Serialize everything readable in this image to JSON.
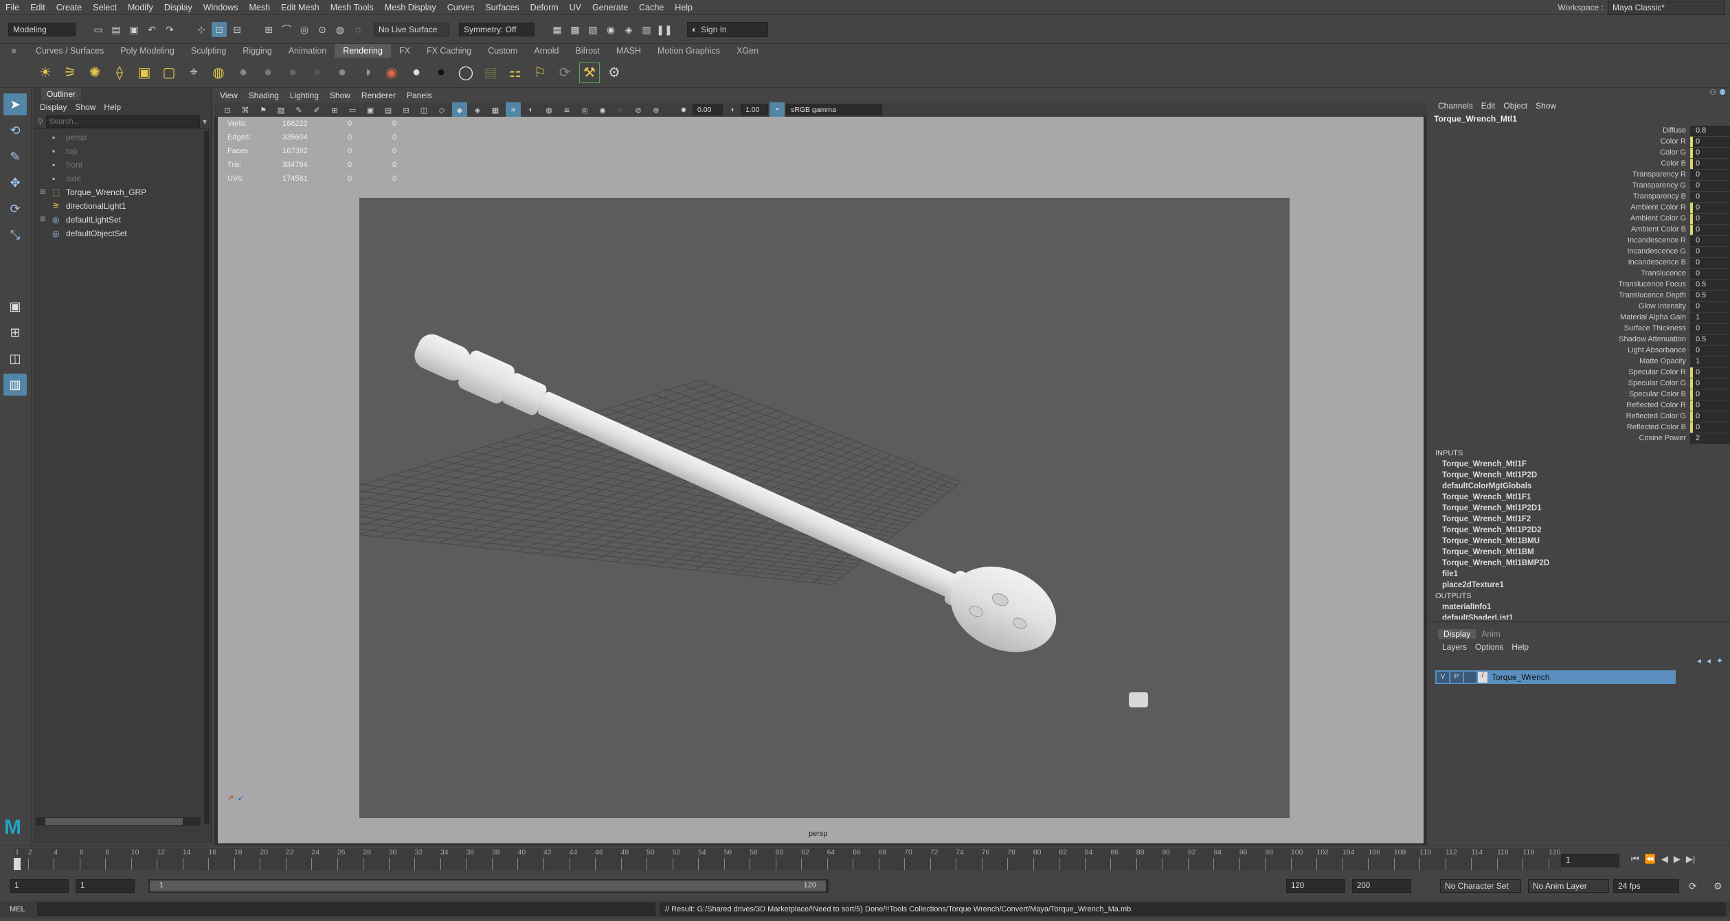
{
  "menubar": {
    "items": [
      "File",
      "Edit",
      "Create",
      "Select",
      "Modify",
      "Display",
      "Windows",
      "Mesh",
      "Edit Mesh",
      "Mesh Tools",
      "Mesh Display",
      "Curves",
      "Surfaces",
      "Deform",
      "UV",
      "Generate",
      "Cache",
      "Help"
    ],
    "workspace_label": "Workspace :",
    "workspace_value": "Maya Classic*"
  },
  "statusline": {
    "mode": "Modeling",
    "live_surface": "No Live Surface",
    "symmetry": "Symmetry: Off",
    "sign_in": "Sign In"
  },
  "shelf": {
    "tabs": [
      "Curves / Surfaces",
      "Poly Modeling",
      "Sculpting",
      "Rigging",
      "Animation",
      "Rendering",
      "FX",
      "FX Caching",
      "Custom",
      "Arnold",
      "Bifrost",
      "MASH",
      "Motion Graphics",
      "XGen"
    ],
    "active_tab": "Rendering"
  },
  "outliner": {
    "title": "Outliner",
    "menu": [
      "Display",
      "Show",
      "Help"
    ],
    "search_placeholder": "Search...",
    "items": [
      {
        "label": "persp",
        "dim": true,
        "expand": ""
      },
      {
        "label": "top",
        "dim": true,
        "expand": ""
      },
      {
        "label": "front",
        "dim": true,
        "expand": ""
      },
      {
        "label": "side",
        "dim": true,
        "expand": ""
      },
      {
        "label": "Torque_Wrench_GRP",
        "dim": false,
        "expand": "+"
      },
      {
        "label": "directionalLight1",
        "dim": false,
        "expand": ""
      },
      {
        "label": "defaultLightSet",
        "dim": false,
        "expand": "+"
      },
      {
        "label": "defaultObjectSet",
        "dim": false,
        "expand": ""
      }
    ]
  },
  "viewport": {
    "menu": [
      "View",
      "Shading",
      "Lighting",
      "Show",
      "Renderer",
      "Panels"
    ],
    "near_value": "0.00",
    "far_value": "1.00",
    "color_space": "sRGB gamma",
    "camera_label": "persp",
    "hud": [
      {
        "label": "Verts:",
        "v1": "168222",
        "v2": "0",
        "v3": "0"
      },
      {
        "label": "Edges:",
        "v1": "335604",
        "v2": "0",
        "v3": "0"
      },
      {
        "label": "Faces:",
        "v1": "167392",
        "v2": "0",
        "v3": "0"
      },
      {
        "label": "Tris:",
        "v1": "334784",
        "v2": "0",
        "v3": "0"
      },
      {
        "label": "UVs:",
        "v1": "174581",
        "v2": "0",
        "v3": "0"
      }
    ]
  },
  "channels": {
    "menu": [
      "Channels",
      "Edit",
      "Object",
      "Show"
    ],
    "node_name": "Torque_Wrench_Mtl1",
    "attributes": [
      {
        "label": "Diffuse",
        "value": "0.8",
        "key": false
      },
      {
        "label": "Color R",
        "value": "0",
        "key": true
      },
      {
        "label": "Color G",
        "value": "0",
        "key": true
      },
      {
        "label": "Color B",
        "value": "0",
        "key": true
      },
      {
        "label": "Transparency R",
        "value": "0",
        "key": false
      },
      {
        "label": "Transparency G",
        "value": "0",
        "key": false
      },
      {
        "label": "Transparency B",
        "value": "0",
        "key": false
      },
      {
        "label": "Ambient Color R",
        "value": "0",
        "key": true
      },
      {
        "label": "Ambient Color G",
        "value": "0",
        "key": true
      },
      {
        "label": "Ambient Color B",
        "value": "0",
        "key": true
      },
      {
        "label": "Incandescence R",
        "value": "0",
        "key": false
      },
      {
        "label": "Incandescence G",
        "value": "0",
        "key": false
      },
      {
        "label": "Incandescence B",
        "value": "0",
        "key": false
      },
      {
        "label": "Translucence",
        "value": "0",
        "key": false
      },
      {
        "label": "Translucence Focus",
        "value": "0.5",
        "key": false
      },
      {
        "label": "Translucence Depth",
        "value": "0.5",
        "key": false
      },
      {
        "label": "Glow Intensity",
        "value": "0",
        "key": false
      },
      {
        "label": "Material Alpha Gain",
        "value": "1",
        "key": false
      },
      {
        "label": "Surface Thickness",
        "value": "0",
        "key": false
      },
      {
        "label": "Shadow Attenuation",
        "value": "0.5",
        "key": false
      },
      {
        "label": "Light Absorbance",
        "value": "0",
        "key": false
      },
      {
        "label": "Matte Opacity",
        "value": "1",
        "key": false
      },
      {
        "label": "Specular Color R",
        "value": "0",
        "key": true
      },
      {
        "label": "Specular Color G",
        "value": "0",
        "key": true
      },
      {
        "label": "Specular Color B",
        "value": "0",
        "key": true
      },
      {
        "label": "Reflected Color R",
        "value": "0",
        "key": true
      },
      {
        "label": "Reflected Color G",
        "value": "0",
        "key": true
      },
      {
        "label": "Reflected Color B",
        "value": "0",
        "key": true
      },
      {
        "label": "Cosine Power",
        "value": "2",
        "key": false
      }
    ],
    "inputs_label": "INPUTS",
    "inputs": [
      "Torque_Wrench_Mtl1F",
      "Torque_Wrench_Mtl1P2D",
      "defaultColorMgtGlobals",
      "Torque_Wrench_Mtl1F1",
      "Torque_Wrench_Mtl1P2D1",
      "Torque_Wrench_Mtl1F2",
      "Torque_Wrench_Mtl1P2D2",
      "Torque_Wrench_Mtl1BMU",
      "Torque_Wrench_Mtl1BM",
      "Torque_Wrench_Mtl1BMP2D",
      "file1",
      "place2dTexture1"
    ],
    "outputs_label": "OUTPUTS",
    "outputs": [
      "materialInfo1",
      "defaultShaderList1"
    ]
  },
  "layers": {
    "tabs": [
      "Display",
      "Anim"
    ],
    "menu": [
      "Layers",
      "Options",
      "Help"
    ],
    "layer_v": "V",
    "layer_p": "P",
    "layer_name": "Torque_Wrench"
  },
  "timeline": {
    "ticks": [
      "1",
      "2",
      "4",
      "6",
      "8",
      "10",
      "12",
      "14",
      "16",
      "18",
      "20",
      "22",
      "24",
      "26",
      "28",
      "30",
      "32",
      "34",
      "36",
      "38",
      "40",
      "42",
      "44",
      "46",
      "48",
      "50",
      "52",
      "54",
      "56",
      "58",
      "60",
      "62",
      "64",
      "66",
      "68",
      "70",
      "72",
      "74",
      "76",
      "78",
      "80",
      "82",
      "84",
      "86",
      "88",
      "90",
      "92",
      "94",
      "96",
      "98",
      "100",
      "102",
      "104",
      "106",
      "108",
      "110",
      "112",
      "114",
      "116",
      "118",
      "120"
    ],
    "current_frame": "1",
    "range_start": "1",
    "playback_start": "1",
    "slider_start": "1",
    "slider_end": "120",
    "range_end": "120",
    "playback_end": "200",
    "character_set": "No Character Set",
    "anim_layer": "No Anim Layer",
    "fps": "24 fps"
  },
  "cmdline": {
    "lang": "MEL",
    "result": "// Result: G:/Shared drives/3D Marketplace/!Need to sort/5) Done/!!Tools Collections/Torque Wrench/Convert/Maya/Torque_Wrench_Ma.mb"
  },
  "colors": {
    "accent": "#5285a6",
    "layer_highlight": "#5a8fbf",
    "key_marker": "#d8d86a",
    "maya_logo": "#21a5c4"
  }
}
